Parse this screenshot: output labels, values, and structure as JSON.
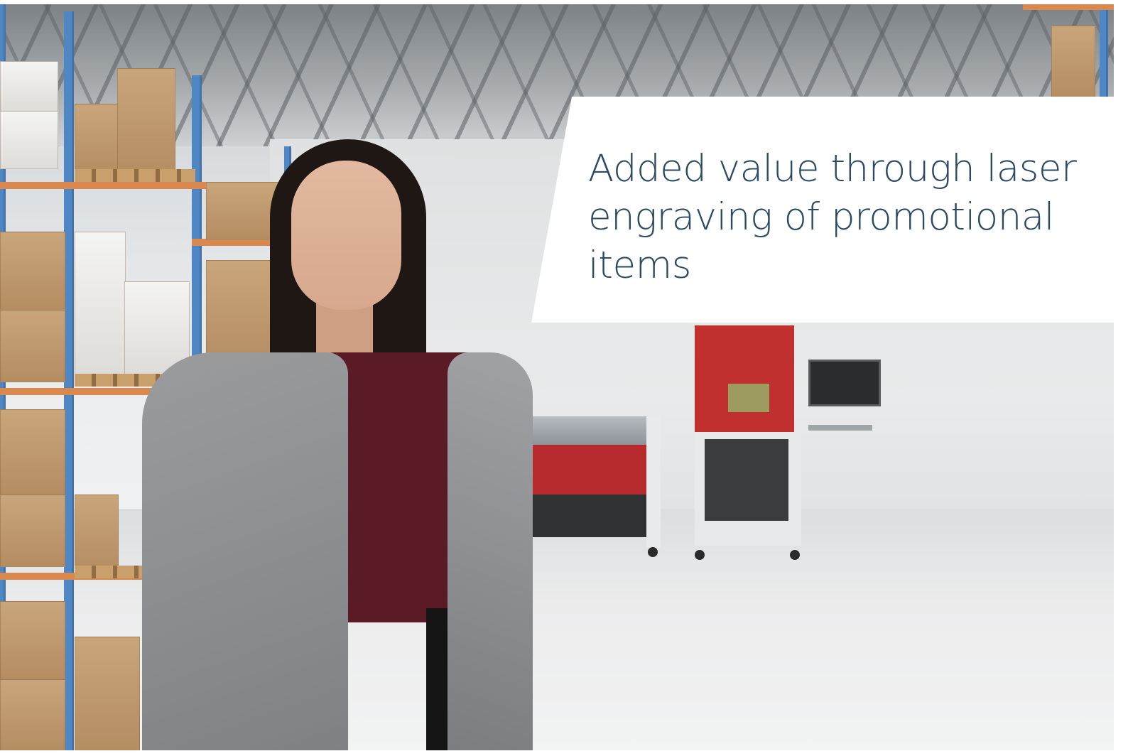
{
  "hero": {
    "headline": "Added value through laser engraving of promotional items",
    "headline_color": "#2c4a63",
    "callout_background": "#ffffff"
  },
  "scene": {
    "accent_red": "#c0302f",
    "shelf_blue": "#4f86c4",
    "shelf_orange": "#d9894f"
  }
}
